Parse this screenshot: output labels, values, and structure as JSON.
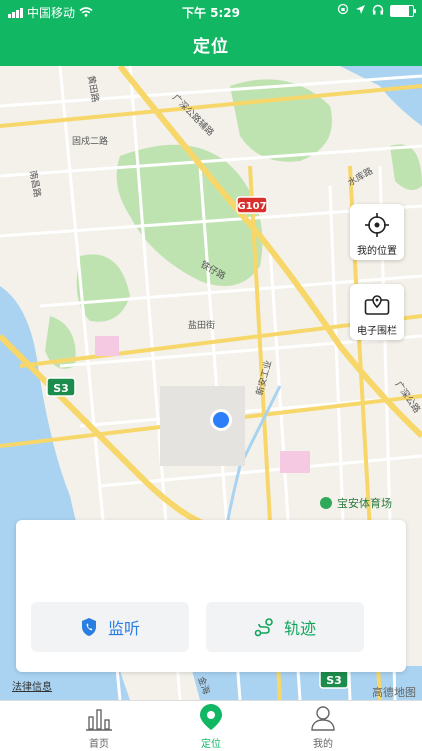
{
  "status_bar": {
    "carrier": "中国移动",
    "time": "下午 5:29"
  },
  "header": {
    "title": "定位"
  },
  "map": {
    "labels": {
      "road_guangshen_aux": "广深公路辅路",
      "road_guangshen": "广深公路",
      "road_huangtian": "黄田路",
      "road_gushu2": "固戍二路",
      "road_nanchang": "南昌路",
      "road_shuiku": "水库路",
      "road_tiezai": "铁仔路",
      "road_yantian": "盐田街",
      "road_xinantian": "新安工业",
      "road_jinhai": "金海",
      "shield_g107": "G107",
      "shield_s3": "S3",
      "shield_s3_bottom": "S3",
      "poi_stadium": "宝安体育场"
    }
  },
  "side_buttons": {
    "my_location": "我的位置",
    "geofence": "电子围栏"
  },
  "panel": {
    "listen_label": "监听",
    "track_label": "轨迹"
  },
  "footer": {
    "legal": "法律信息",
    "map_provider": "高德地图"
  },
  "tabs": [
    {
      "label": "首页"
    },
    {
      "label": "定位"
    },
    {
      "label": "我的"
    }
  ],
  "colors": {
    "brand_green": "#12b764",
    "listen_blue": "#2a7de1",
    "water": "#a9d3f1",
    "park": "#bfe3b0"
  }
}
